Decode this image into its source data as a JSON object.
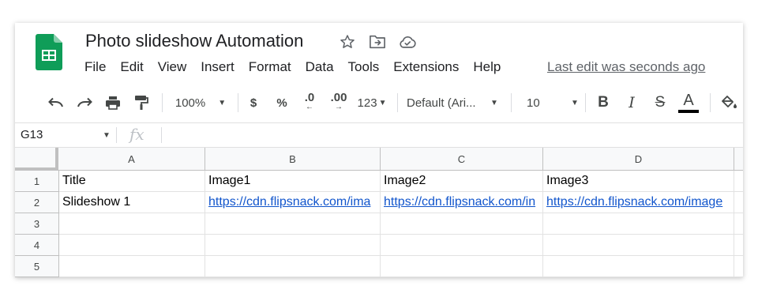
{
  "document": {
    "title": "Photo slideshow Automation",
    "last_edit": "Last edit was seconds ago"
  },
  "menu": [
    "File",
    "Edit",
    "View",
    "Insert",
    "Format",
    "Data",
    "Tools",
    "Extensions",
    "Help"
  ],
  "toolbar": {
    "zoom": "100%",
    "currency": "$",
    "percent": "%",
    "decrease_decimal": ".0",
    "increase_decimal": ".00",
    "more_formats": "123",
    "font": "Default (Ari...",
    "font_size": "10",
    "bold": "B",
    "italic": "I",
    "strikethrough": "S",
    "text_color_letter": "A",
    "text_color": "#000000"
  },
  "formula_bar": {
    "cell_ref": "G13",
    "fx": "fx",
    "content": ""
  },
  "sheet": {
    "columns": [
      "A",
      "B",
      "C",
      "D"
    ],
    "rows": [
      "1",
      "2",
      "3",
      "4",
      "5"
    ],
    "cells": [
      [
        "Title",
        "Image1",
        "Image2",
        "Image3"
      ],
      [
        "Slideshow 1",
        "https://cdn.flipsnack.com/ima",
        "https://cdn.flipsnack.com/in",
        "https://cdn.flipsnack.com/image"
      ],
      [
        "",
        "",
        "",
        ""
      ],
      [
        "",
        "",
        "",
        ""
      ],
      [
        "",
        "",
        "",
        ""
      ]
    ],
    "link_color": "#1155cc"
  },
  "brand_color": "#0f9d58"
}
